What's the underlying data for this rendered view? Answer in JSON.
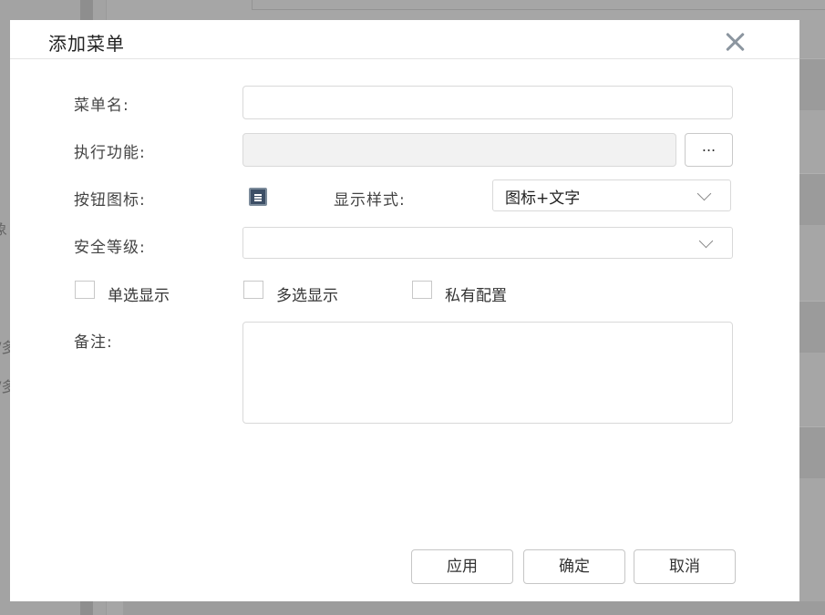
{
  "background": {
    "side_chars": [
      "象",
      "/多",
      "/多"
    ]
  },
  "dialog": {
    "title": "添加菜单",
    "close_icon": "close-icon",
    "fields": {
      "menu_name": {
        "label": "菜单名:",
        "value": ""
      },
      "function": {
        "label": "执行功能:",
        "value": "",
        "browse_label": "..."
      },
      "button_icon": {
        "label": "按钮图标:",
        "icon": "menu-list-icon"
      },
      "display_style": {
        "label": "显示样式:",
        "value": "图标+文字"
      },
      "security_level": {
        "label": "安全等级:",
        "value": ""
      },
      "remark": {
        "label": "备注:",
        "value": ""
      }
    },
    "checkboxes": [
      {
        "label": "单选显示",
        "checked": false
      },
      {
        "label": "多选显示",
        "checked": false
      },
      {
        "label": "私有配置",
        "checked": false
      }
    ],
    "buttons": {
      "apply": "应用",
      "confirm": "确定",
      "cancel": "取消"
    }
  }
}
